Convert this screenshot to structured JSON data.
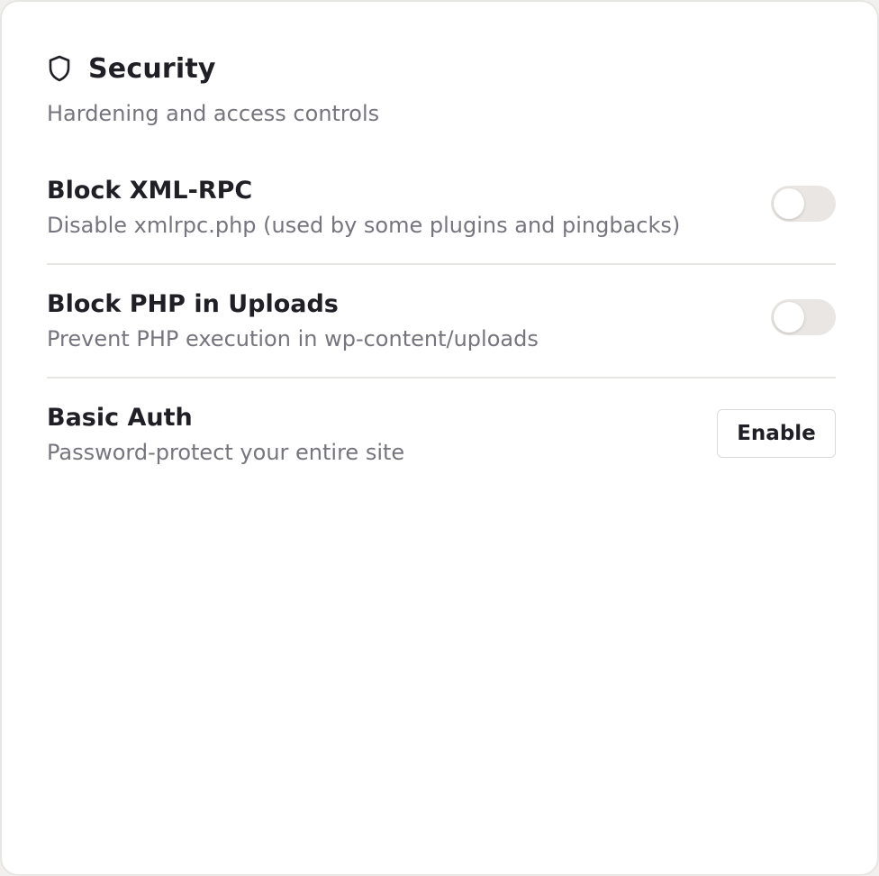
{
  "card": {
    "icon": "shield-icon",
    "title": "Security",
    "subtitle": "Hardening and access controls"
  },
  "settings": [
    {
      "title": "Block XML-RPC",
      "description": "Disable xmlrpc.php (used by some plugins and pingbacks)",
      "control": "toggle",
      "enabled": false
    },
    {
      "title": "Block PHP in Uploads",
      "description": "Prevent PHP execution in wp-content/uploads",
      "control": "toggle",
      "enabled": false
    },
    {
      "title": "Basic Auth",
      "description": "Password-protect your entire site",
      "control": "button",
      "button_label": "Enable"
    }
  ],
  "colors": {
    "title_text": "#1f1f25",
    "muted_text": "#75757d",
    "divider": "#e8e6e3",
    "toggle_off_track": "#e9e6e3"
  }
}
